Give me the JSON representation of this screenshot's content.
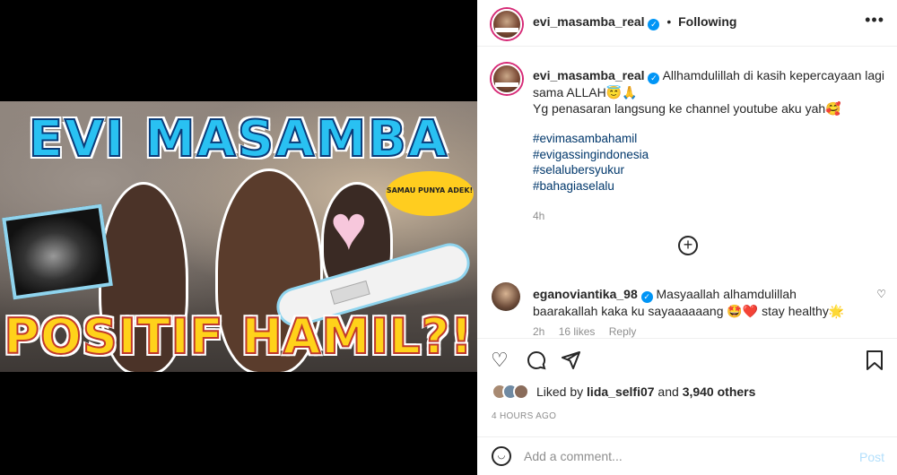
{
  "media": {
    "thumbnail_title": "EVI MASAMBA",
    "thumbnail_subtitle": "POSITIF HAMIL?!",
    "speech_bubble": "SAMAU PUNYA ADEK!"
  },
  "header": {
    "username": "evi_masamba_real",
    "separator": "•",
    "follow_status": "Following",
    "more_icon": "more-horizontal-icon"
  },
  "caption": {
    "username": "evi_masamba_real",
    "line1": "Allhamdulillah di kasih kepercayaan lagi sama ALLAH😇🙏",
    "line2": "Yg penasaran langsung ke channel youtube aku yah🥰",
    "hashtags": [
      "#evimasambahamil",
      "#evigassingindonesia",
      "#selalubersyukur",
      "#bahagiaselalu"
    ],
    "time": "4h"
  },
  "load_more_icon": "plus-circle-icon",
  "comment": {
    "username": "eganoviantika_98",
    "text": "Masyaallah alhamdulillah baarakallah kaka ku sayaaaaaang 🤩❤️ stay healthy🌟",
    "time": "2h",
    "likes": "16 likes",
    "reply": "Reply"
  },
  "actions": {
    "heart_icon": "heart-icon",
    "comment_icon": "comment-icon",
    "share_icon": "send-icon",
    "save_icon": "bookmark-icon"
  },
  "likes": {
    "prefix": "Liked by ",
    "user": "lida_selfi07",
    "middle": " and ",
    "others": "3,940 others"
  },
  "post_age": "4 HOURS AGO",
  "add_comment": {
    "placeholder": "Add a comment...",
    "post_label": "Post"
  },
  "colors": {
    "link": "#00376b",
    "verified": "#0095f6",
    "muted": "#8e8e8e",
    "post_disabled": "#b2dffc"
  }
}
